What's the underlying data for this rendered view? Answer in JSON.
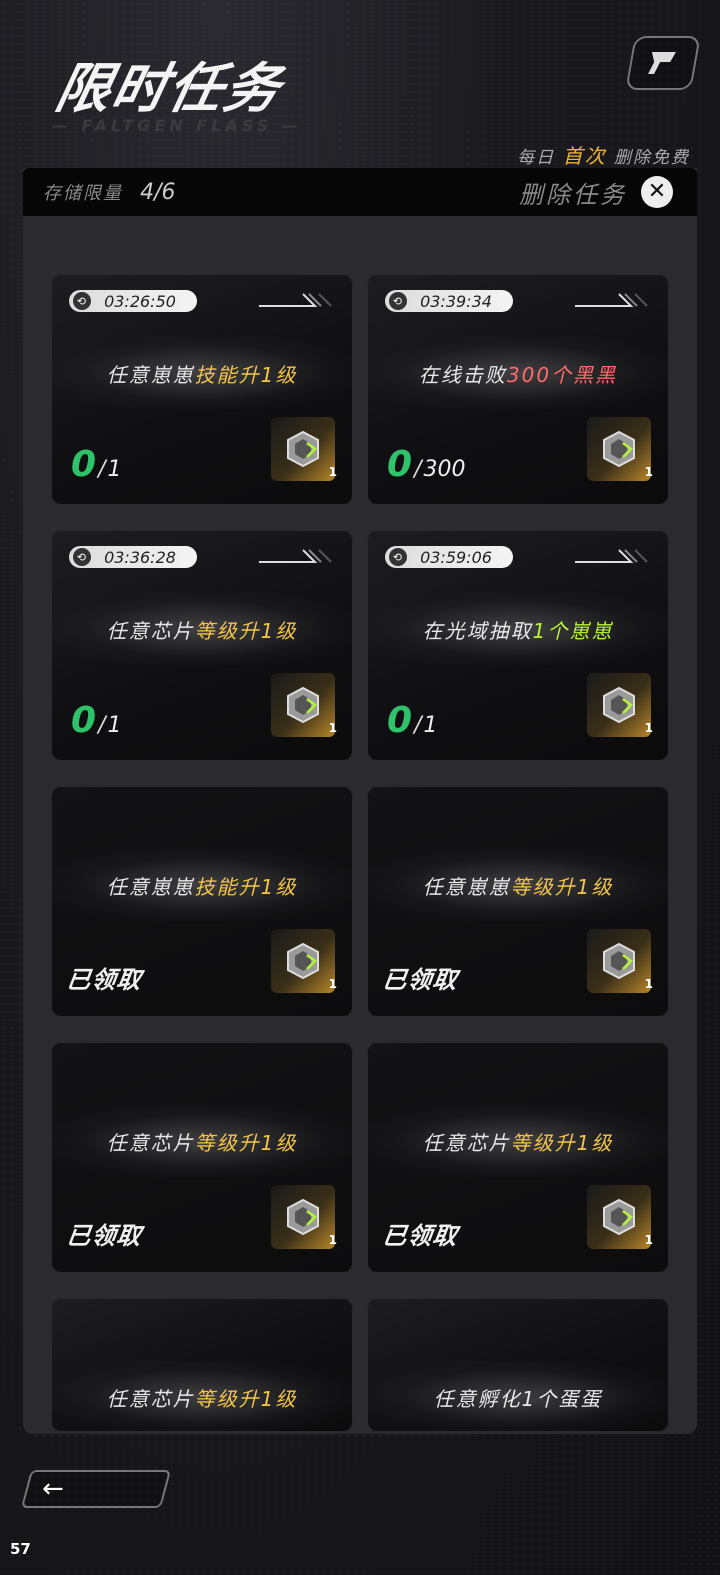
{
  "header": {
    "title": "限时任务",
    "subtitle": "— FALTGEN FLASS —",
    "daily_prefix": "每日",
    "daily_highlight": "首次",
    "daily_suffix": "删除免费"
  },
  "panel": {
    "capacity_label": "存储限量",
    "capacity_value": "4/6",
    "delete_label": "删除任务",
    "close_glyph": "✕"
  },
  "tasks": [
    {
      "timer": "03:26:50",
      "pre": "任意崽崽",
      "highlight": "技能升1级",
      "post": "",
      "hl_color": "yellow",
      "current": "0",
      "total": "1",
      "status": "active",
      "reward_count": "1"
    },
    {
      "timer": "03:39:34",
      "pre": "在线击败",
      "highlight": "300个黑黑",
      "post": "",
      "hl_color": "red",
      "current": "0",
      "total": "300",
      "status": "active",
      "reward_count": "1"
    },
    {
      "timer": "03:36:28",
      "pre": "任意芯片",
      "highlight": "等级升1级",
      "post": "",
      "hl_color": "yellow",
      "current": "0",
      "total": "1",
      "status": "active",
      "reward_count": "1"
    },
    {
      "timer": "03:59:06",
      "pre": "在光域抽取",
      "highlight": "1个崽崽",
      "post": "",
      "hl_color": "green",
      "current": "0",
      "total": "1",
      "status": "active",
      "reward_count": "1"
    },
    {
      "pre": "任意崽崽",
      "highlight": "技能升1级",
      "post": "",
      "hl_color": "yellow",
      "status": "claimed",
      "claimed_label": "已领取",
      "reward_count": "1"
    },
    {
      "pre": "任意崽崽",
      "highlight": "等级升1级",
      "post": "",
      "hl_color": "yellow",
      "status": "claimed",
      "claimed_label": "已领取",
      "reward_count": "1"
    },
    {
      "pre": "任意芯片",
      "highlight": "等级升1级",
      "post": "",
      "hl_color": "yellow",
      "status": "claimed",
      "claimed_label": "已领取",
      "reward_count": "1"
    },
    {
      "pre": "任意芯片",
      "highlight": "等级升1级",
      "post": "",
      "hl_color": "yellow",
      "status": "claimed",
      "claimed_label": "已领取",
      "reward_count": "1"
    },
    {
      "pre": "任意芯片",
      "highlight": "等级升1级",
      "post": "",
      "hl_color": "yellow",
      "status": "partial"
    },
    {
      "pre": "任意孵化",
      "highlight": "1个蛋蛋",
      "post": "",
      "hl_color": "white",
      "status": "partial"
    }
  ],
  "footer": {
    "back_glyph": "←",
    "fps": "57"
  },
  "icons": {
    "timer": "clock-icon",
    "reward": "chip-gem-icon",
    "back": "arrow-left-icon",
    "corner": "logo-icon"
  }
}
